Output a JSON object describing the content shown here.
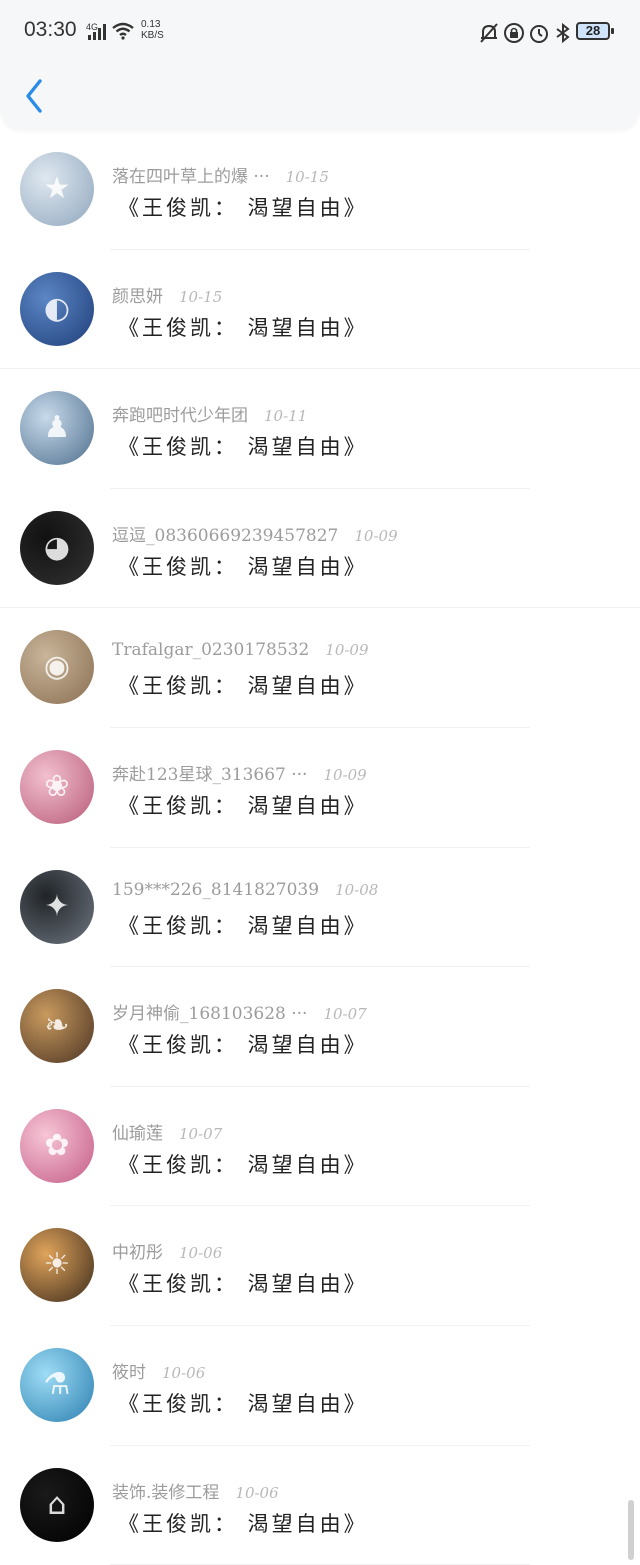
{
  "status_bar": {
    "time": "03:30",
    "network": "4G",
    "speed_value": "0.13",
    "speed_unit": "KB/S",
    "battery": "28"
  },
  "header": {
    "back_icon": "chevron-left-icon",
    "accent": "#2b8ce6"
  },
  "items": [
    {
      "name": "落在四叶草上的爆 ···",
      "date": "10-15",
      "title": "《王俊凯： 渴望自由》",
      "avatar_colors": [
        "#dfe8f0",
        "#8fa6bd"
      ],
      "avatar_glyph": "★"
    },
    {
      "name": "颜思妍",
      "date": "10-15",
      "title": "《王俊凯： 渴望自由》",
      "avatar_colors": [
        "#5b86c4",
        "#1f3f7a"
      ],
      "avatar_glyph": "◐"
    },
    {
      "name": "奔跑吧时代少年团",
      "date": "10-11",
      "title": "《王俊凯： 渴望自由》",
      "avatar_colors": [
        "#c7d9ea",
        "#4e6f8d"
      ],
      "avatar_glyph": "♟"
    },
    {
      "name": "逗逗_08360669239457827",
      "date": "10-09",
      "title": "《王俊凯： 渴望自由》",
      "avatar_colors": [
        "#111111",
        "#333333"
      ],
      "avatar_glyph": "◕"
    },
    {
      "name": "Trafalgar_0230178532",
      "date": "10-09",
      "title": "《王俊凯： 渴望自由》",
      "avatar_colors": [
        "#c9b59a",
        "#8a6f52"
      ],
      "avatar_glyph": "◉"
    },
    {
      "name": "奔赴123星球_313667 ···",
      "date": "10-09",
      "title": "《王俊凯： 渴望自由》",
      "avatar_colors": [
        "#f2c0cf",
        "#b85b78"
      ],
      "avatar_glyph": "❀"
    },
    {
      "name": "159***226_8141827039",
      "date": "10-08",
      "title": "《王俊凯： 渴望自由》",
      "avatar_colors": [
        "#202428",
        "#6f7680"
      ],
      "avatar_glyph": "✦"
    },
    {
      "name": "岁月神偷_168103628 ···",
      "date": "10-07",
      "title": "《王俊凯： 渴望自由》",
      "avatar_colors": [
        "#c89a5e",
        "#4b3323"
      ],
      "avatar_glyph": "❧"
    },
    {
      "name": "仙瑜莲",
      "date": "10-07",
      "title": "《王俊凯： 渴望自由》",
      "avatar_colors": [
        "#f7c6d6",
        "#c45b86"
      ],
      "avatar_glyph": "✿"
    },
    {
      "name": "中初彤",
      "date": "10-06",
      "title": "《王俊凯： 渴望自由》",
      "avatar_colors": [
        "#e0a45b",
        "#3b2a1b"
      ],
      "avatar_glyph": "☀"
    },
    {
      "name": "筱时",
      "date": "10-06",
      "title": "《王俊凯： 渴望自由》",
      "avatar_colors": [
        "#9fdcf5",
        "#2a7fb0"
      ],
      "avatar_glyph": "⚗"
    },
    {
      "name": "装饰.装修工程",
      "date": "10-06",
      "title": "《王俊凯： 渴望自由》",
      "avatar_colors": [
        "#1a1a1a",
        "#000000"
      ],
      "avatar_glyph": "⌂"
    }
  ]
}
